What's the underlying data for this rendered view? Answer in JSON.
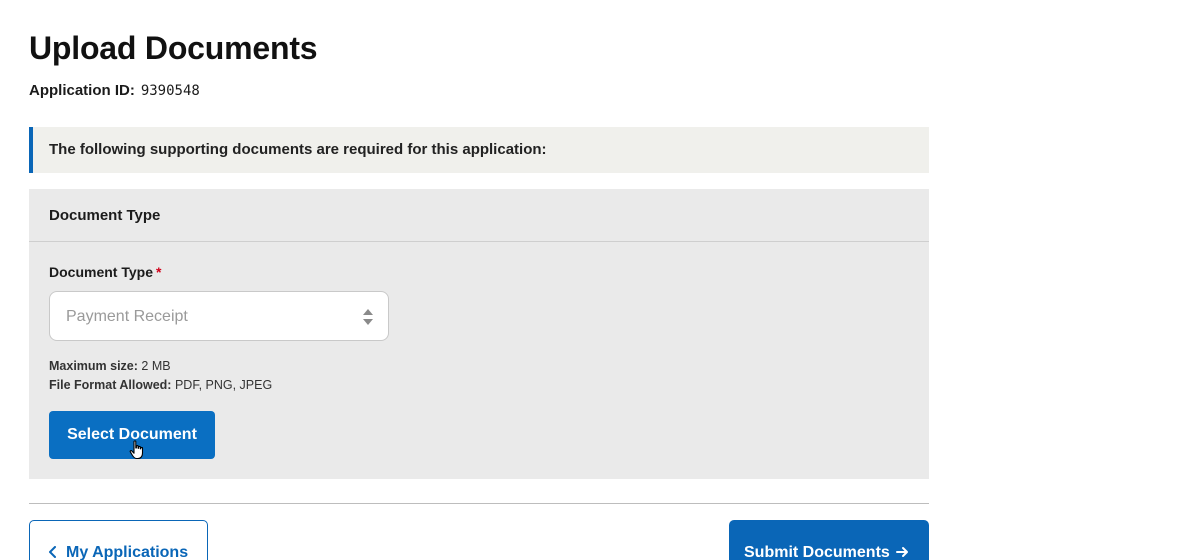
{
  "header": {
    "title": "Upload Documents",
    "application_id_label": "Application ID:",
    "application_id_value": "9390548"
  },
  "notice": {
    "text": "The following supporting documents are required for this application:"
  },
  "panel": {
    "header": "Document Type",
    "field_label": "Document Type",
    "required_marker": "*",
    "select_value": "Payment Receipt",
    "max_size_label": "Maximum size:",
    "max_size_value": "2 MB",
    "formats_label": "File Format Allowed:",
    "formats_value": "PDF, PNG, JPEG",
    "select_button_label": "Select Document"
  },
  "footer": {
    "back_button_label": "My Applications",
    "submit_button_label": "Submit Documents"
  },
  "colors": {
    "primary": "#0a66b7",
    "notice_bg": "#f0f0ec",
    "panel_bg": "#eaeaea",
    "required": "#d0021b"
  },
  "icons": {
    "back": "chevron-left-icon",
    "submit": "arrow-right-icon",
    "select": "sort-arrows-icon",
    "cursor": "hand-pointer-icon"
  }
}
